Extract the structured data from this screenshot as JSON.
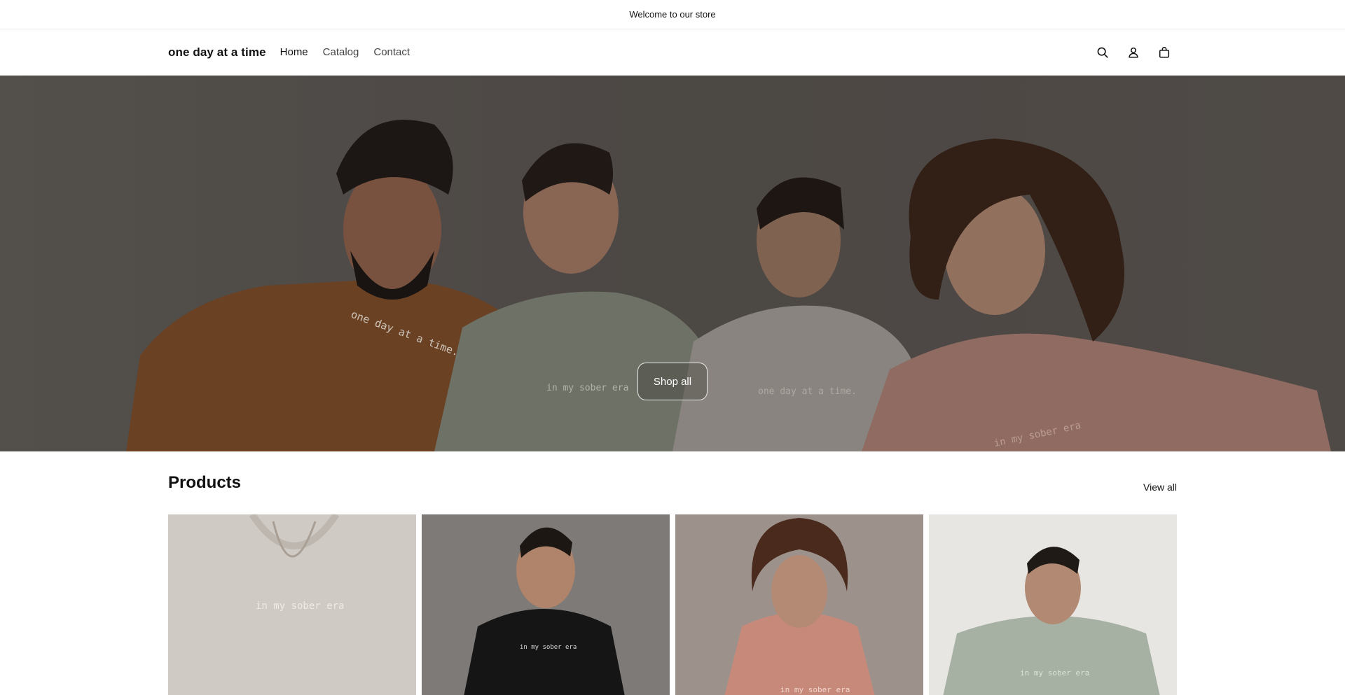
{
  "announcement": {
    "text": "Welcome to our store"
  },
  "header": {
    "logo": "one day at a time",
    "nav": [
      {
        "label": "Home"
      },
      {
        "label": "Catalog"
      },
      {
        "label": "Contact"
      }
    ],
    "icons": [
      "search-icon",
      "account-icon",
      "cart-icon"
    ]
  },
  "hero": {
    "button_label": "Shop all",
    "garment_texts": [
      "one day at a time.",
      "in my sober era",
      "one day at a time.",
      "in my sober era"
    ]
  },
  "products": {
    "title": "Products",
    "view_all_label": "View all",
    "cards": [
      {
        "print_text": "in my sober era"
      },
      {
        "print_text": "in my sober era"
      },
      {
        "print_text": "in my sober era"
      },
      {
        "print_text": "in my sober era"
      }
    ]
  }
}
